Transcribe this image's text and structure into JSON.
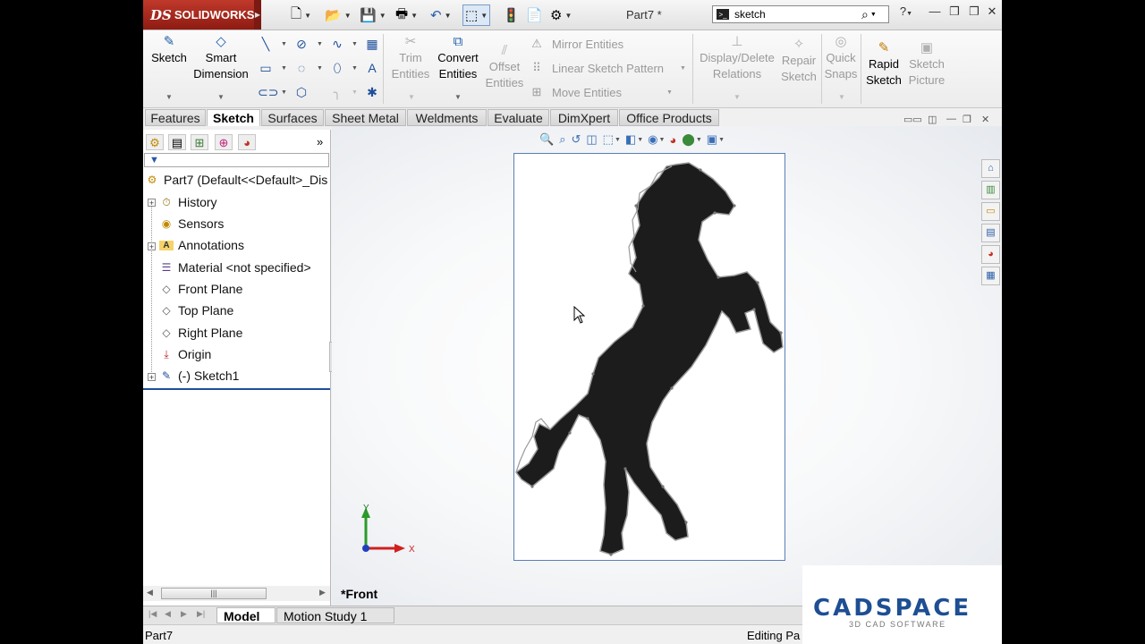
{
  "app": {
    "brand": "SOLIDWORKS",
    "brand_mark": "DS",
    "doc_title": "Part7 *"
  },
  "search": {
    "value": "sketch",
    "cmd_label": ">_"
  },
  "quick_access": {
    "new": "🗋",
    "open": "📂",
    "save": "💾",
    "print": "🖶",
    "undo": "↶",
    "select": "⬚",
    "rebuild": "🚦",
    "file_props": "📄",
    "options": "⚙"
  },
  "window_controls": {
    "help": "?",
    "minimize": "—",
    "restore": "❐",
    "maximize": "❐",
    "close": "✕"
  },
  "ribbon": {
    "sketch": "Sketch",
    "smart_dimension": [
      "Smart",
      "Dimension"
    ],
    "trim_entities": [
      "Trim",
      "Entities"
    ],
    "convert_entities": [
      "Convert",
      "Entities"
    ],
    "offset_entities": [
      "Offset",
      "Entities"
    ],
    "mirror_entities": "Mirror Entities",
    "linear_sketch_pattern": "Linear Sketch Pattern",
    "move_entities": "Move Entities",
    "display_delete_relations": [
      "Display/Delete",
      "Relations"
    ],
    "repair_sketch": [
      "Repair",
      "Sketch"
    ],
    "quick_snaps": [
      "Quick",
      "Snaps"
    ],
    "rapid_sketch": [
      "Rapid",
      "Sketch"
    ],
    "sketch_picture": [
      "Sketch",
      "Picture"
    ]
  },
  "tabs": [
    "Features",
    "Sketch",
    "Surfaces",
    "Sheet Metal",
    "Weldments",
    "Evaluate",
    "DimXpert",
    "Office Products"
  ],
  "tree": {
    "root": "Part7  (Default<<Default>_Dis",
    "items": [
      "History",
      "Sensors",
      "Annotations",
      "Material <not specified>",
      "Front Plane",
      "Top Plane",
      "Right Plane",
      "Origin",
      "(-) Sketch1"
    ]
  },
  "viewport": {
    "view_label": "*Front",
    "axis_y": "Y",
    "axis_x": "X"
  },
  "bottom_tabs": [
    "Model",
    "Motion Study 1"
  ],
  "status": {
    "left": "Part7",
    "right": "Editing Pa"
  },
  "watermark": {
    "title": "CADSPACE",
    "subtitle": "3D CAD SOFTWARE"
  },
  "colors": {
    "accent": "#1f4f9a",
    "brand_red": "#a8281c",
    "horse_fill": "#1c1c1c"
  }
}
